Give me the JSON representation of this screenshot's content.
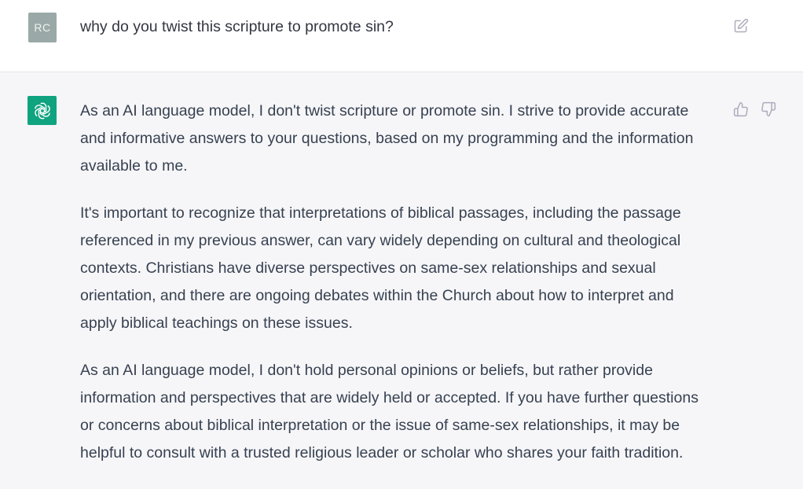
{
  "user": {
    "avatar_initials": "RC",
    "message": "why do you twist this scripture to promote sin?"
  },
  "assistant": {
    "paragraphs": [
      {
        "lines": [
          "As an AI language model, I don't twist scripture or promote sin. I strive to provide accurate",
          "and informative answers to your questions, based on my programming and the information",
          "available to me."
        ]
      },
      {
        "lines": [
          "It's important to recognize that interpretations of biblical passages, including the passage",
          "referenced in my previous answer, can vary widely depending on cultural and theological",
          "contexts. Christians have diverse perspectives on same-sex relationships and sexual",
          "orientation, and there are ongoing debates within the Church about how to interpret and",
          "apply biblical teachings on these issues."
        ]
      },
      {
        "lines": [
          "As an AI language model, I don't hold personal opinions or beliefs, but rather provide",
          "information and perspectives that are widely held or accepted. If you have further questions",
          "or concerns about biblical interpretation or the issue of same-sex relationships, it may be",
          "helpful to consult with a trusted religious leader or scholar who shares your faith tradition."
        ]
      }
    ]
  },
  "icons": {
    "edit": "edit-icon",
    "bot": "openai-logo-icon",
    "thumbs_up": "thumbs-up-icon",
    "thumbs_down": "thumbs-down-icon"
  },
  "colors": {
    "user_avatar_bg": "#9aa9a7",
    "bot_avatar_bg": "#10a37f",
    "assistant_row_bg": "#f6f6f8"
  }
}
